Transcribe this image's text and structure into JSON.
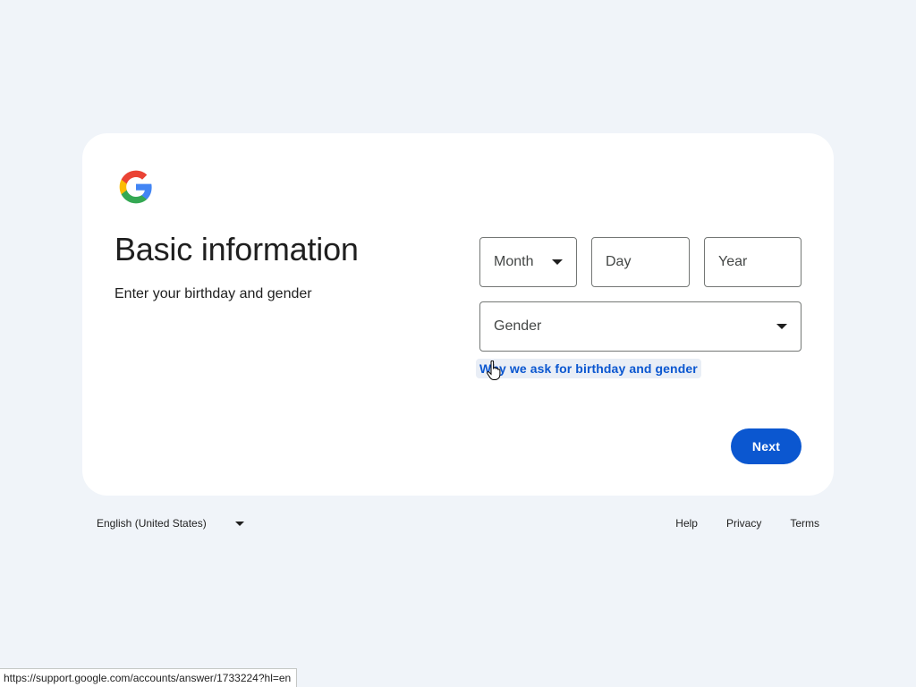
{
  "card": {
    "logo_icon": "google-g-logo",
    "heading": "Basic information",
    "subheading": "Enter your birthday and gender",
    "month_label": "Month",
    "day_label": "Day",
    "year_label": "Year",
    "gender_label": "Gender",
    "why_link": "Why we ask for birthday and gender",
    "next_label": "Next"
  },
  "footer": {
    "language": "English (United States)",
    "links": [
      "Help",
      "Privacy",
      "Terms"
    ]
  },
  "status_bar": {
    "url": "https://support.google.com/accounts/answer/1733224?hl=en"
  },
  "colors": {
    "background": "#f0f4f9",
    "card": "#ffffff",
    "accent": "#0b57d0",
    "link_highlight": "#e9eef6",
    "field_border": "#747775"
  }
}
